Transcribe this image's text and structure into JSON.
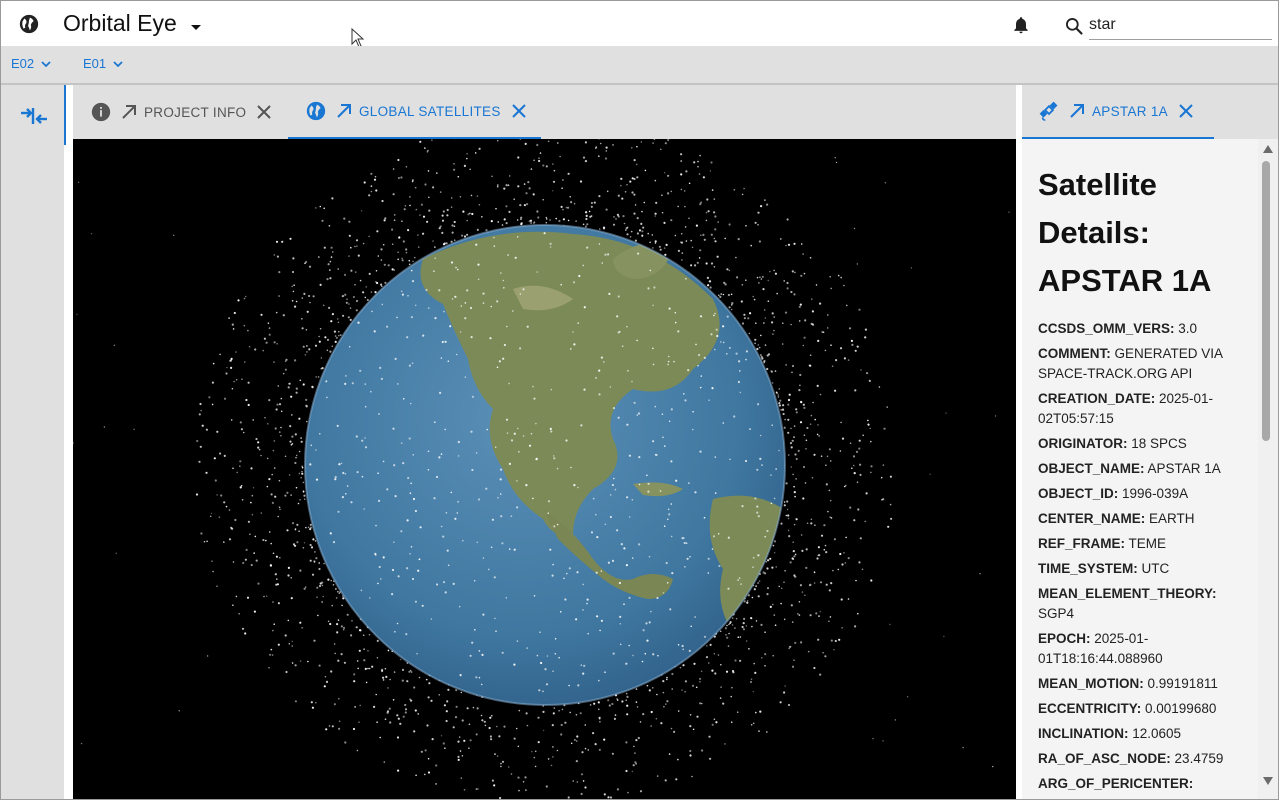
{
  "app": {
    "title": "Orbital Eye",
    "globe_icon": "globe-icon",
    "notifications_icon": "bell-icon"
  },
  "search": {
    "value": "star",
    "icon": "search-icon"
  },
  "environments": [
    {
      "label": "E02"
    },
    {
      "label": "E01"
    }
  ],
  "tabs": [
    {
      "label": "PROJECT INFO",
      "icon": "info-icon",
      "active": false
    },
    {
      "label": "GLOBAL SATELLITES",
      "icon": "globe-icon",
      "active": true
    }
  ],
  "right_tab": {
    "label": "APSTAR 1A",
    "icon": "satellite-icon"
  },
  "details": {
    "title_line1": "Satellite",
    "title_line2": "Details:",
    "title_line3": "APSTAR 1A",
    "fields": [
      {
        "key": "CCSDS_OMM_VERS:",
        "value": "3.0"
      },
      {
        "key": "COMMENT:",
        "value": "GENERATED VIA SPACE-TRACK.ORG API"
      },
      {
        "key": "CREATION_DATE:",
        "value": "2025-01-02T05:57:15"
      },
      {
        "key": "ORIGINATOR:",
        "value": "18 SPCS"
      },
      {
        "key": "OBJECT_NAME:",
        "value": "APSTAR 1A"
      },
      {
        "key": "OBJECT_ID:",
        "value": "1996-039A"
      },
      {
        "key": "CENTER_NAME:",
        "value": "EARTH"
      },
      {
        "key": "REF_FRAME:",
        "value": "TEME"
      },
      {
        "key": "TIME_SYSTEM:",
        "value": "UTC"
      },
      {
        "key": "MEAN_ELEMENT_THEORY:",
        "value": "SGP4"
      },
      {
        "key": "EPOCH:",
        "value": "2025-01-01T18:16:44.088960"
      },
      {
        "key": "MEAN_MOTION:",
        "value": "0.99191811"
      },
      {
        "key": "ECCENTRICITY:",
        "value": "0.00199680"
      },
      {
        "key": "INCLINATION:",
        "value": "12.0605"
      },
      {
        "key": "RA_OF_ASC_NODE:",
        "value": "23.4759"
      },
      {
        "key": "ARG_OF_PERICENTER:",
        "value": ""
      }
    ]
  },
  "colors": {
    "accent": "#1976d2",
    "bar_bg": "#e0e0e0",
    "space": "#000000",
    "ocean": "#3f77a0",
    "land": "#7c8a57"
  }
}
